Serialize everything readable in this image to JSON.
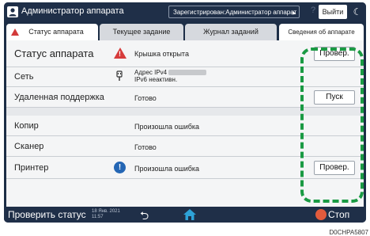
{
  "titlebar": {
    "title": "Администратор аппарата",
    "login_label": "Зарегистрирован:Администратор аппарат",
    "help": "?",
    "logout": "Выйти",
    "moon": "☾"
  },
  "tabs": [
    {
      "label": "Статус аппарата"
    },
    {
      "label": "Текущее задание"
    },
    {
      "label": "Журнал заданий"
    },
    {
      "label": "Сведения об аппарате"
    }
  ],
  "rows": [
    {
      "name": "Статус аппарата",
      "status": "Крышка открыта",
      "icon": "warning-icon",
      "button": "Провер."
    },
    {
      "name": "Сеть",
      "status_line1": "Адрес IPv4",
      "status_line2": "IPv6 неактивн.",
      "icon": "network-icon"
    },
    {
      "name": "Удаленная поддержка",
      "status": "Готово",
      "button": "Пуск"
    },
    {
      "name": "Копир",
      "status": "Произошла ошибка"
    },
    {
      "name": "Сканер",
      "status": "Готово"
    },
    {
      "name": "Принтер",
      "status": "Произошла ошибка",
      "icon": "info-icon",
      "button": "Провер."
    }
  ],
  "bottombar": {
    "check_status": "Проверить статус",
    "date": "18 Янв. 2021",
    "time": "11:57",
    "stop": "Стоп"
  },
  "caption": "D0CHPA5807",
  "colors": {
    "highlight": "#1a9a43",
    "header": "#1f2f48",
    "warning": "#d63b3b",
    "info": "#2466b4"
  }
}
